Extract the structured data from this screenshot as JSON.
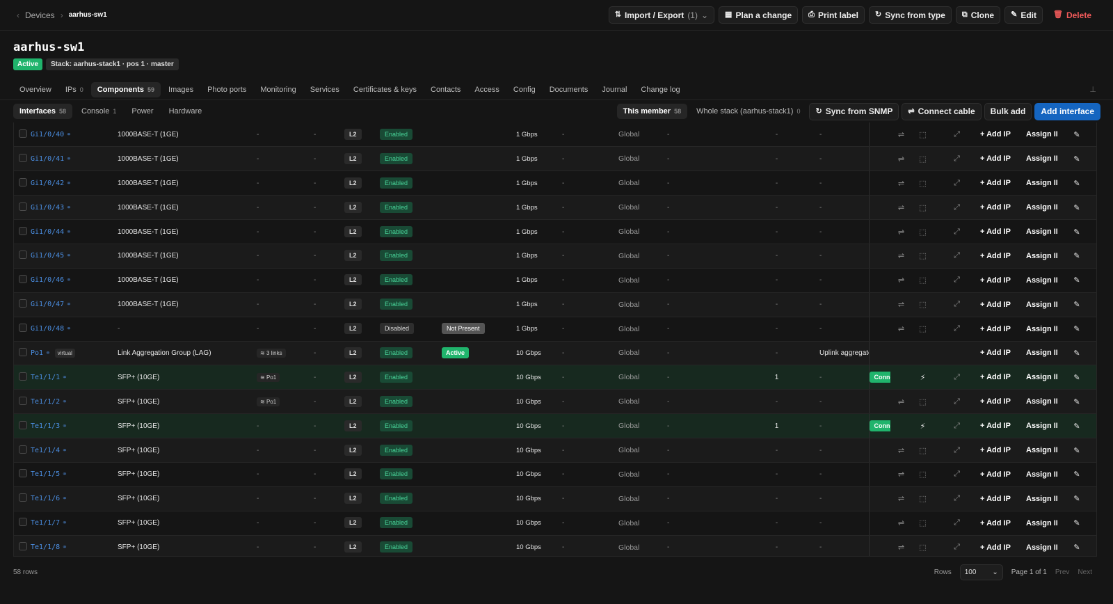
{
  "breadcrumb": {
    "parent": "Devices",
    "current": "aarhus-sw1"
  },
  "toolbar": {
    "import_export": "Import / Export",
    "import_export_count": "(1)",
    "plan_change": "Plan a change",
    "print_label": "Print label",
    "sync_from_type": "Sync from type",
    "clone": "Clone",
    "edit": "Edit",
    "delete": "Delete"
  },
  "device": {
    "name": "aarhus-sw1",
    "status": "Active",
    "stack": "Stack: aarhus-stack1 · pos 1 · master"
  },
  "tabs": [
    {
      "label": "Overview",
      "count": ""
    },
    {
      "label": "IPs",
      "count": "0"
    },
    {
      "label": "Components",
      "count": "59"
    },
    {
      "label": "Images",
      "count": ""
    },
    {
      "label": "Photo ports",
      "count": ""
    },
    {
      "label": "Monitoring",
      "count": ""
    },
    {
      "label": "Services",
      "count": ""
    },
    {
      "label": "Certificates & keys",
      "count": ""
    },
    {
      "label": "Contacts",
      "count": ""
    },
    {
      "label": "Access",
      "count": ""
    },
    {
      "label": "Config",
      "count": ""
    },
    {
      "label": "Documents",
      "count": ""
    },
    {
      "label": "Journal",
      "count": ""
    },
    {
      "label": "Change log",
      "count": ""
    }
  ],
  "subtabs": [
    {
      "label": "Interfaces",
      "count": "58"
    },
    {
      "label": "Console",
      "count": "1"
    },
    {
      "label": "Power",
      "count": ""
    },
    {
      "label": "Hardware",
      "count": ""
    }
  ],
  "scope": {
    "this_member": "This member",
    "this_member_count": "58",
    "whole_stack": "Whole stack (aarhus-stack1)",
    "whole_stack_count": "0"
  },
  "actions": {
    "sync_snmp": "Sync from SNMP",
    "connect_cable": "Connect cable",
    "bulk_add": "Bulk add",
    "add_interface": "Add interface"
  },
  "row_actions": {
    "add_ip": "+ Add IP",
    "assign_ip": "Assign IP"
  },
  "rows": [
    {
      "name": "Gi1/0/40",
      "type": "1000BASE-T (1GE)",
      "lag": "-",
      "parent": "-",
      "mode": "L2",
      "enabled": "Enabled",
      "oper": "",
      "speed": "1 Gbps",
      "mtu": "-",
      "vrf": "Global",
      "vlan": "-",
      "cables": "-",
      "desc": "-",
      "conn": "",
      "virtual": ""
    },
    {
      "name": "Gi1/0/41",
      "type": "1000BASE-T (1GE)",
      "lag": "-",
      "parent": "-",
      "mode": "L2",
      "enabled": "Enabled",
      "oper": "",
      "speed": "1 Gbps",
      "mtu": "-",
      "vrf": "Global",
      "vlan": "-",
      "cables": "-",
      "desc": "-",
      "conn": "",
      "virtual": ""
    },
    {
      "name": "Gi1/0/42",
      "type": "1000BASE-T (1GE)",
      "lag": "-",
      "parent": "-",
      "mode": "L2",
      "enabled": "Enabled",
      "oper": "",
      "speed": "1 Gbps",
      "mtu": "-",
      "vrf": "Global",
      "vlan": "-",
      "cables": "-",
      "desc": "-",
      "conn": "",
      "virtual": ""
    },
    {
      "name": "Gi1/0/43",
      "type": "1000BASE-T (1GE)",
      "lag": "-",
      "parent": "-",
      "mode": "L2",
      "enabled": "Enabled",
      "oper": "",
      "speed": "1 Gbps",
      "mtu": "-",
      "vrf": "Global",
      "vlan": "-",
      "cables": "-",
      "desc": "-",
      "conn": "",
      "virtual": ""
    },
    {
      "name": "Gi1/0/44",
      "type": "1000BASE-T (1GE)",
      "lag": "-",
      "parent": "-",
      "mode": "L2",
      "enabled": "Enabled",
      "oper": "",
      "speed": "1 Gbps",
      "mtu": "-",
      "vrf": "Global",
      "vlan": "-",
      "cables": "-",
      "desc": "-",
      "conn": "",
      "virtual": ""
    },
    {
      "name": "Gi1/0/45",
      "type": "1000BASE-T (1GE)",
      "lag": "-",
      "parent": "-",
      "mode": "L2",
      "enabled": "Enabled",
      "oper": "",
      "speed": "1 Gbps",
      "mtu": "-",
      "vrf": "Global",
      "vlan": "-",
      "cables": "-",
      "desc": "-",
      "conn": "",
      "virtual": ""
    },
    {
      "name": "Gi1/0/46",
      "type": "1000BASE-T (1GE)",
      "lag": "-",
      "parent": "-",
      "mode": "L2",
      "enabled": "Enabled",
      "oper": "",
      "speed": "1 Gbps",
      "mtu": "-",
      "vrf": "Global",
      "vlan": "-",
      "cables": "-",
      "desc": "-",
      "conn": "",
      "virtual": ""
    },
    {
      "name": "Gi1/0/47",
      "type": "1000BASE-T (1GE)",
      "lag": "-",
      "parent": "-",
      "mode": "L2",
      "enabled": "Enabled",
      "oper": "",
      "speed": "1 Gbps",
      "mtu": "-",
      "vrf": "Global",
      "vlan": "-",
      "cables": "-",
      "desc": "-",
      "conn": "",
      "virtual": ""
    },
    {
      "name": "Gi1/0/48",
      "type": "-",
      "lag": "-",
      "parent": "-",
      "mode": "L2",
      "enabled": "Disabled",
      "oper": "Not Present",
      "speed": "1 Gbps",
      "mtu": "-",
      "vrf": "Global",
      "vlan": "-",
      "cables": "-",
      "desc": "-",
      "conn": "",
      "virtual": ""
    },
    {
      "name": "Po1",
      "type": "Link Aggregation Group (LAG)",
      "lag": "3 links",
      "parent": "-",
      "mode": "L2",
      "enabled": "Enabled",
      "oper": "Active",
      "speed": "10 Gbps",
      "mtu": "-",
      "vrf": "Global",
      "vlan": "-",
      "cables": "-",
      "desc": "Uplink aggregate",
      "conn": "",
      "virtual": "virtual"
    },
    {
      "name": "Te1/1/1",
      "type": "SFP+ (10GE)",
      "lag": "Po1",
      "parent": "-",
      "mode": "L2",
      "enabled": "Enabled",
      "oper": "",
      "speed": "10 Gbps",
      "mtu": "-",
      "vrf": "Global",
      "vlan": "-",
      "cables": "1",
      "desc": "-",
      "conn": "Connected",
      "virtual": ""
    },
    {
      "name": "Te1/1/2",
      "type": "SFP+ (10GE)",
      "lag": "Po1",
      "parent": "-",
      "mode": "L2",
      "enabled": "Enabled",
      "oper": "",
      "speed": "10 Gbps",
      "mtu": "-",
      "vrf": "Global",
      "vlan": "-",
      "cables": "-",
      "desc": "-",
      "conn": "",
      "virtual": ""
    },
    {
      "name": "Te1/1/3",
      "type": "SFP+ (10GE)",
      "lag": "-",
      "parent": "-",
      "mode": "L2",
      "enabled": "Enabled",
      "oper": "",
      "speed": "10 Gbps",
      "mtu": "-",
      "vrf": "Global",
      "vlan": "-",
      "cables": "1",
      "desc": "-",
      "conn": "Connected",
      "virtual": ""
    },
    {
      "name": "Te1/1/4",
      "type": "SFP+ (10GE)",
      "lag": "-",
      "parent": "-",
      "mode": "L2",
      "enabled": "Enabled",
      "oper": "",
      "speed": "10 Gbps",
      "mtu": "-",
      "vrf": "Global",
      "vlan": "-",
      "cables": "-",
      "desc": "-",
      "conn": "",
      "virtual": ""
    },
    {
      "name": "Te1/1/5",
      "type": "SFP+ (10GE)",
      "lag": "-",
      "parent": "-",
      "mode": "L2",
      "enabled": "Enabled",
      "oper": "",
      "speed": "10 Gbps",
      "mtu": "-",
      "vrf": "Global",
      "vlan": "-",
      "cables": "-",
      "desc": "-",
      "conn": "",
      "virtual": ""
    },
    {
      "name": "Te1/1/6",
      "type": "SFP+ (10GE)",
      "lag": "-",
      "parent": "-",
      "mode": "L2",
      "enabled": "Enabled",
      "oper": "",
      "speed": "10 Gbps",
      "mtu": "-",
      "vrf": "Global",
      "vlan": "-",
      "cables": "-",
      "desc": "-",
      "conn": "",
      "virtual": ""
    },
    {
      "name": "Te1/1/7",
      "type": "SFP+ (10GE)",
      "lag": "-",
      "parent": "-",
      "mode": "L2",
      "enabled": "Enabled",
      "oper": "",
      "speed": "10 Gbps",
      "mtu": "-",
      "vrf": "Global",
      "vlan": "-",
      "cables": "-",
      "desc": "-",
      "conn": "",
      "virtual": ""
    },
    {
      "name": "Te1/1/8",
      "type": "SFP+ (10GE)",
      "lag": "-",
      "parent": "-",
      "mode": "L2",
      "enabled": "Enabled",
      "oper": "",
      "speed": "10 Gbps",
      "mtu": "-",
      "vrf": "Global",
      "vlan": "-",
      "cables": "-",
      "desc": "-",
      "conn": "",
      "virtual": ""
    }
  ],
  "footer": {
    "rows_count": "58 rows",
    "rows_label": "Rows",
    "rows_per_page": "100",
    "page": "Page 1 of 1",
    "prev": "Prev",
    "next": "Next"
  }
}
